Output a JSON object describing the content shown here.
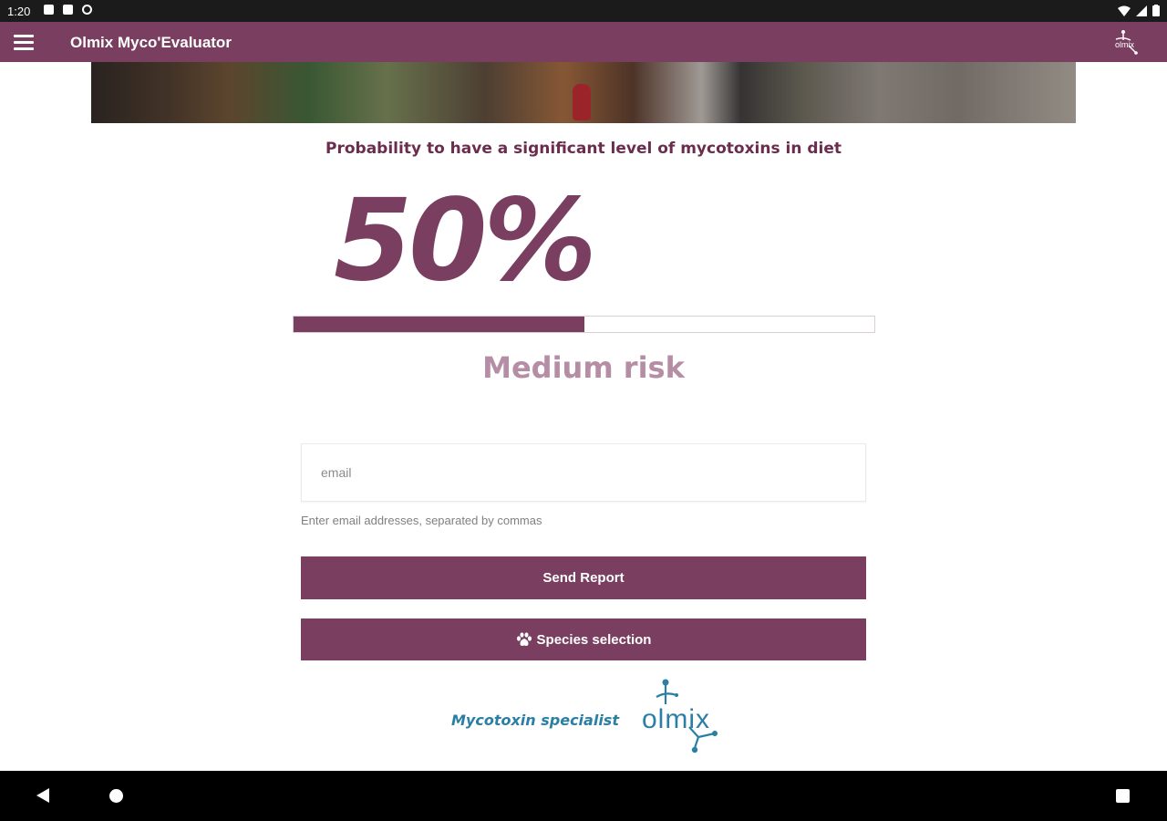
{
  "status_bar": {
    "time": "1:20",
    "left_icons": [
      "app-notification-icon",
      "sim-card-icon",
      "data-saver-icon"
    ],
    "right_icons": [
      "wifi-icon",
      "signal-icon",
      "battery-icon"
    ]
  },
  "app_bar": {
    "title": "Olmix Myco'Evaluator",
    "menu_icon": "hamburger-menu-icon",
    "logo_icon": "olmix-logo-icon"
  },
  "result": {
    "title": "Probability to have a significant level of mycotoxins in diet",
    "percent_label": "50%",
    "progress_fraction": 0.5,
    "risk_label": "Medium risk"
  },
  "form": {
    "email_placeholder": "email",
    "email_value": "",
    "email_hint": "Enter email addresses, separated by commas",
    "send_button_label": "Send Report",
    "species_button_label": "Species selection",
    "species_icon": "paw-icon"
  },
  "footer": {
    "tagline": "Mycotoxin specialist",
    "logo_icon": "olmix-logo-icon"
  },
  "nav_bar": {
    "icons": [
      "back-icon",
      "home-icon",
      "recents-icon"
    ]
  },
  "colors": {
    "primary": "#7a3f60",
    "risk_text": "#b58ea5",
    "footer_blue": "#2b7fa5"
  }
}
